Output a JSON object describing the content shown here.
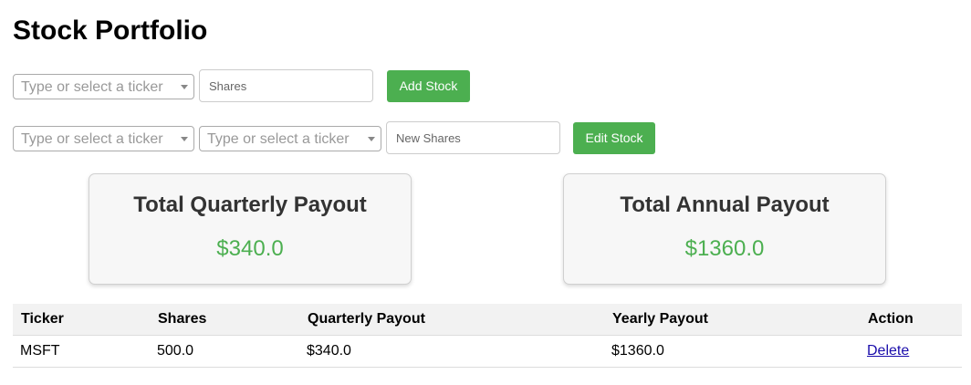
{
  "title": "Stock Portfolio",
  "add_form": {
    "ticker_placeholder": "Type or select a ticker",
    "shares_placeholder": "Shares",
    "button_label": "Add Stock"
  },
  "edit_form": {
    "ticker_placeholder": "Type or select a ticker",
    "new_ticker_placeholder": "Type or select a ticker",
    "shares_placeholder": "New Shares",
    "button_label": "Edit Stock"
  },
  "cards": {
    "quarterly": {
      "label": "Total Quarterly Payout",
      "value": "$340.0"
    },
    "annual": {
      "label": "Total Annual Payout",
      "value": "$1360.0"
    }
  },
  "table": {
    "headers": [
      "Ticker",
      "Shares",
      "Quarterly Payout",
      "Yearly Payout",
      "Action"
    ],
    "rows": [
      {
        "ticker": "MSFT",
        "shares": "500.0",
        "quarterly": "$340.0",
        "yearly": "$1360.0",
        "action": "Delete"
      }
    ]
  },
  "colors": {
    "accent_green": "#4CAF50",
    "link": "#1a0dab"
  }
}
